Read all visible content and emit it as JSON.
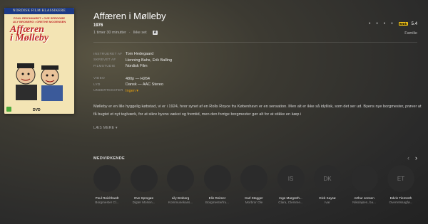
{
  "poster": {
    "band": "NORDISK FILM KLASSIKERE",
    "credits": [
      "POUL REICHHARDT • OVE SPROGØE",
      "LILY BROBERG • GRETHE MOGENSEN"
    ],
    "title_line1": "Affæren",
    "title_line2": "i Mølleby",
    "rating_badge": "A",
    "dvd_label": "DVD"
  },
  "movie": {
    "title": "Affæren i Mølleby",
    "year": "1976",
    "duration": "1 timer 30 minutter",
    "separator": "·",
    "watched": "Ikke set",
    "content_rating": "A",
    "imdb_label": "IMDb",
    "score": "5.4",
    "genre": "Familie",
    "more_dots": "• • • •"
  },
  "info": {
    "director_label": "INSTRUERET AF",
    "director": "Tom Hedegaard",
    "writer_label": "SKREVET AF",
    "writer": "Henning Bahs, Erik Balling",
    "studio_label": "FILMSTUDIE",
    "studio": "Nordisk Film",
    "video_label": "VIDEO",
    "video": "480p — H264",
    "audio_label": "LYD",
    "audio": "Dansk — AAC Stereo",
    "subs_label": "UNDERTEKSTER",
    "subs": "Ingen ▾"
  },
  "description": "Mølleby er en lille hyggelig købstad, vi er i 1924, hvor synet af en Rolls Royce fra København er en sensation. Men alt er ikke så idyllisk, som det ser ud. Byens nye borgmester, prøver at få bugtet et nyt teglværk, for at sikre byens vækst og fremtid, men den forrige borgmester gør alt for at stikke en kæp i",
  "more_label": "LÆS MERE ▾",
  "cast_heading": "MEDVIRKENDE",
  "nav": {
    "prev": "‹",
    "next": "›"
  },
  "cast": [
    {
      "initials": "",
      "name": "Poul Reichhardt",
      "role": "Borgmester Cl..."
    },
    {
      "initials": "",
      "name": "Ove Sprogøe",
      "role": "Digter Morten..."
    },
    {
      "initials": "",
      "name": "Lily Broberg",
      "role": "Kommunekass..."
    },
    {
      "initials": "",
      "name": "Elin Reimer",
      "role": "Borgmesterfru..."
    },
    {
      "initials": "",
      "name": "Karl Stegger",
      "role": "Morbror Ole"
    },
    {
      "initials": "IS",
      "name": "Inge Margreth...",
      "role": "Clara, Clemme..."
    },
    {
      "initials": "DK",
      "name": "Dick Kaysø",
      "role": "Ivar"
    },
    {
      "initials": "",
      "name": "Arthur Jensen",
      "role": "Nikolajsen, ba..."
    },
    {
      "initials": "ET",
      "name": "Edvin Tiemroth",
      "role": "Overretssagfø..."
    }
  ]
}
